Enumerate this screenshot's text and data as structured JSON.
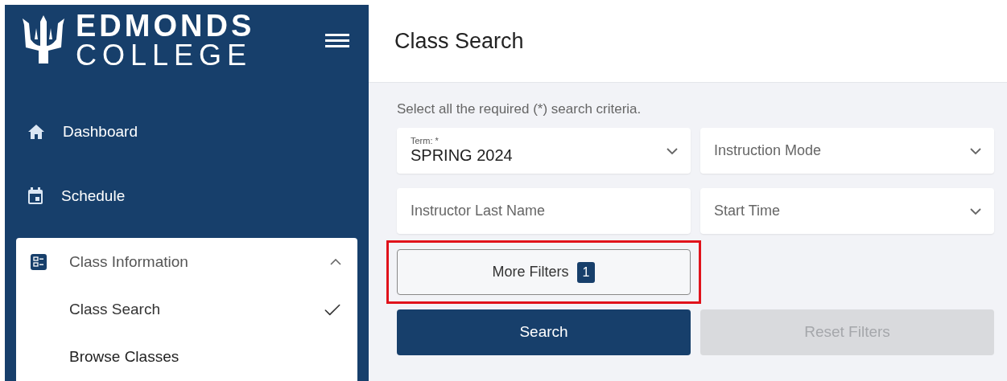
{
  "logo": {
    "line1": "EDMONDS",
    "line2": "COLLEGE"
  },
  "nav": [
    {
      "label": "Dashboard",
      "kind": "home"
    },
    {
      "label": "Schedule",
      "kind": "calendar"
    }
  ],
  "nav_group": {
    "label": "Class Information",
    "expanded": true,
    "children": [
      {
        "label": "Class Search",
        "selected": true
      },
      {
        "label": "Browse Classes",
        "selected": false
      }
    ]
  },
  "page_title": "Class Search",
  "instructions": "Select all the required (*) search criteria.",
  "fields": [
    {
      "kind": "select",
      "label": "Term: *",
      "value": "SPRING 2024"
    },
    {
      "kind": "select",
      "placeholder": "Instruction Mode"
    },
    {
      "kind": "text",
      "placeholder": "Instructor Last Name"
    },
    {
      "kind": "select",
      "placeholder": "Start Time"
    }
  ],
  "more_filters": {
    "label": "More Filters",
    "count": "1",
    "highlighted": true
  },
  "buttons": [
    {
      "label": "Search",
      "disabled": false
    },
    {
      "label": "Reset Filters",
      "disabled": true
    }
  ]
}
